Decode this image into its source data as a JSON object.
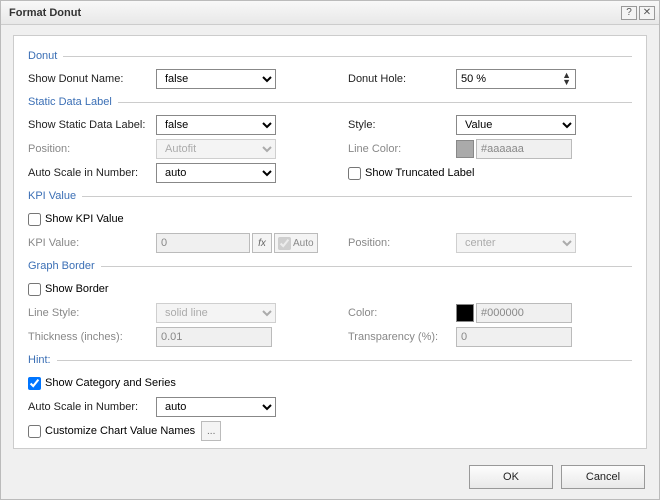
{
  "title": "Format Donut",
  "sections": {
    "donut": {
      "header": "Donut",
      "showName": {
        "label": "Show Donut Name:",
        "value": "false"
      },
      "hole": {
        "label": "Donut Hole:",
        "value": "50 %"
      }
    },
    "staticLabel": {
      "header": "Static Data Label",
      "show": {
        "label": "Show Static Data Label:",
        "value": "false"
      },
      "style": {
        "label": "Style:",
        "value": "Value"
      },
      "position": {
        "label": "Position:",
        "value": "Autofit"
      },
      "lineColor": {
        "label": "Line Color:",
        "value": "#aaaaaa",
        "swatch": "#aaaaaa"
      },
      "autoScale": {
        "label": "Auto Scale in Number:",
        "value": "auto"
      },
      "showTruncated": {
        "label": "Show Truncated Label",
        "checked": false
      }
    },
    "kpi": {
      "header": "KPI Value",
      "show": {
        "label": "Show KPI Value",
        "checked": false
      },
      "value": {
        "label": "KPI Value:",
        "value": "0"
      },
      "fx": {
        "label": "fx"
      },
      "auto": {
        "label": "Auto",
        "checked": true
      },
      "position": {
        "label": "Position:",
        "value": "center"
      }
    },
    "border": {
      "header": "Graph Border",
      "show": {
        "label": "Show Border",
        "checked": false
      },
      "style": {
        "label": "Line Style:",
        "value": "solid line"
      },
      "color": {
        "label": "Color:",
        "value": "#000000",
        "swatch": "#000000"
      },
      "thick": {
        "label": "Thickness (inches):",
        "value": "0.01"
      },
      "trans": {
        "label": "Transparency (%):",
        "value": "0"
      }
    },
    "hint": {
      "header": "Hint:",
      "showCatSeries": {
        "label": "Show Category and Series",
        "checked": true
      },
      "autoScale": {
        "label": "Auto Scale in Number:",
        "value": "auto"
      },
      "customize": {
        "label": "Customize Chart Value Names",
        "checked": false,
        "btn": "..."
      }
    }
  },
  "footer": {
    "ok": "OK",
    "cancel": "Cancel"
  }
}
